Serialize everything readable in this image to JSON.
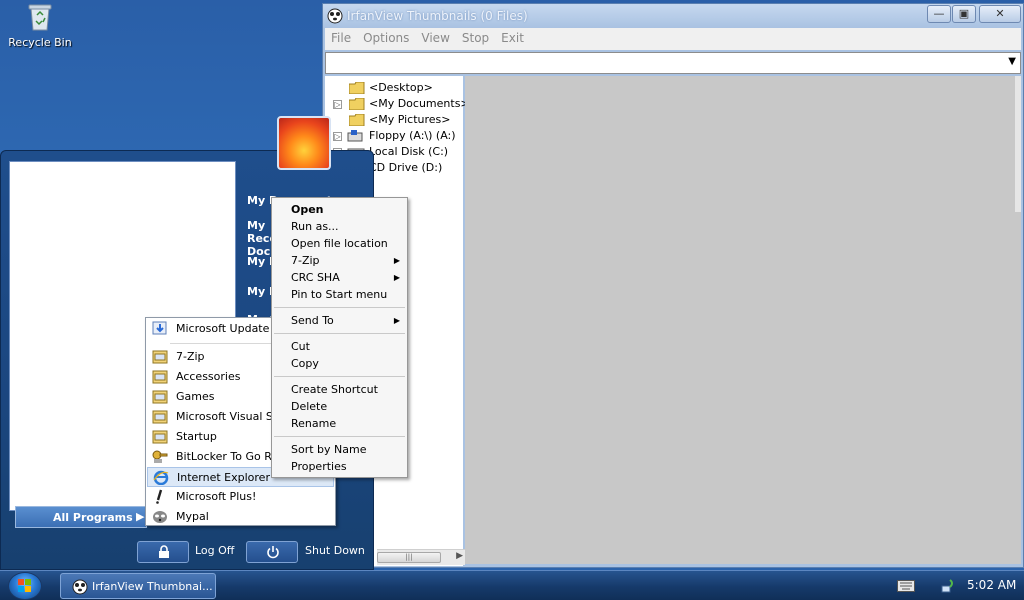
{
  "desktop": {
    "icons": [
      {
        "label": "Recycle Bin",
        "icon": "recycle-bin-icon"
      }
    ]
  },
  "window": {
    "title": "IrfanView Thumbnails (0 Files)",
    "menu": [
      "File",
      "Options",
      "View",
      "Stop",
      "Exit"
    ],
    "path_value": "",
    "tree": [
      {
        "label": "<Desktop>",
        "icon": "folder-icon",
        "expandable": false
      },
      {
        "label": "<My Documents>",
        "icon": "folder-icon",
        "expandable": true
      },
      {
        "label": "<My Pictures>",
        "icon": "folder-icon",
        "expandable": false
      },
      {
        "label": "Floppy (A:\\) (A:)",
        "icon": "floppy-drive-icon",
        "expandable": true
      },
      {
        "label": "Local Disk (C:)",
        "icon": "hard-drive-icon",
        "expandable": true
      },
      {
        "label": "CD Drive (D:)",
        "icon": "cd-drive-icon",
        "expandable": false
      }
    ]
  },
  "start_menu": {
    "right_links": [
      "My Documents",
      "My Recent Documents",
      "My Pictures",
      "My Music",
      "My Computer"
    ],
    "all_programs_label": "All Programs",
    "logoff_label": "Log Off",
    "shutdown_label": "Shut Down"
  },
  "programs_menu": {
    "items": [
      {
        "label": "Microsoft Update",
        "icon": "update-icon"
      },
      {
        "label": "7-Zip",
        "icon": "program-group-icon"
      },
      {
        "label": "Accessories",
        "icon": "program-group-icon"
      },
      {
        "label": "Games",
        "icon": "program-group-icon"
      },
      {
        "label": "Microsoft Visual St",
        "icon": "program-group-icon"
      },
      {
        "label": "Startup",
        "icon": "program-group-icon"
      },
      {
        "label": "BitLocker To Go Re",
        "icon": "bitlocker-icon"
      },
      {
        "label": "Internet Explorer",
        "icon": "internet-explorer-icon"
      },
      {
        "label": "Microsoft Plus!",
        "icon": "microsoft-plus-icon"
      },
      {
        "label": "Mypal",
        "icon": "mypal-icon"
      }
    ]
  },
  "context_menu": {
    "items": [
      {
        "label": "Open",
        "bold": true
      },
      {
        "label": "Run as..."
      },
      {
        "label": "Open file location"
      },
      {
        "label": "7-Zip",
        "submenu": true
      },
      {
        "label": "CRC SHA",
        "submenu": true
      },
      {
        "label": "Pin to Start menu"
      },
      {
        "label": "Send To",
        "submenu": true
      },
      {
        "label": "Cut"
      },
      {
        "label": "Copy"
      },
      {
        "label": "Create Shortcut"
      },
      {
        "label": "Delete"
      },
      {
        "label": "Rename"
      },
      {
        "label": "Sort by Name"
      },
      {
        "label": "Properties"
      }
    ]
  },
  "taskbar": {
    "task_label": "IrfanView Thumbnai...",
    "clock": "5:02 AM"
  }
}
